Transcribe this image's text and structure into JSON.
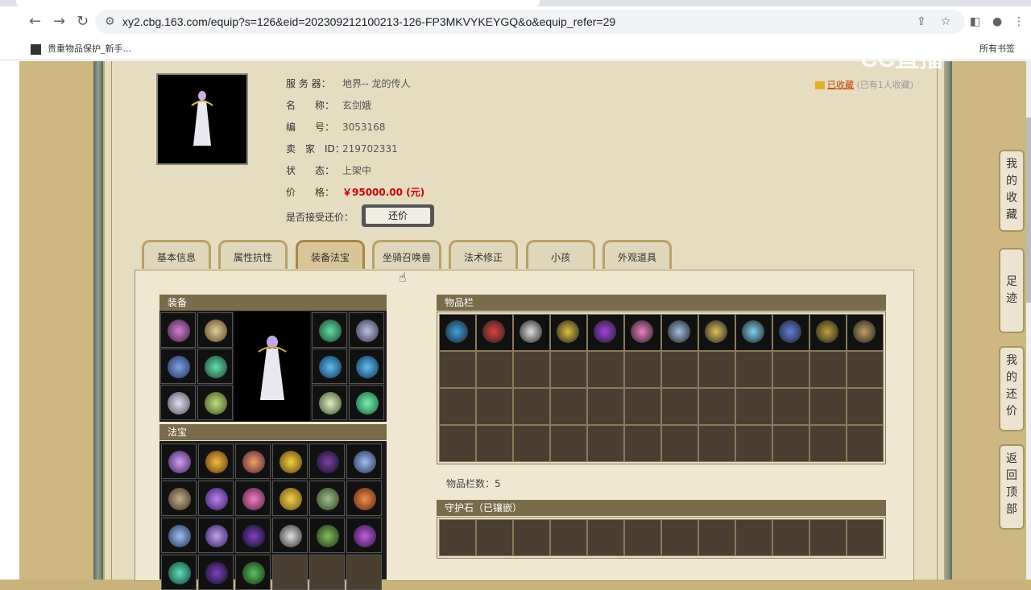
{
  "browser": {
    "url": "xy2.cbg.163.com/equip?s=126&eid=202309212100213-126-FP3MKVYKEYGQ&o&equip_refer=29",
    "bookmark": "贵重物品保护_新手...",
    "all_bookmarks": "所有书签",
    "watermark": "CC直播"
  },
  "product": {
    "server_label": "服 务 器：",
    "server": "地界-- 龙的传人",
    "name_label": "名　　称：",
    "name": "玄剑娥",
    "id_label": "编　　号：",
    "id": "3053168",
    "seller_label": "卖　家　ID：",
    "seller_id": "219702331",
    "status_label": "状　　态：",
    "status": "上架中",
    "price_label": "价　　格：",
    "price": "￥95000.00 (元)",
    "bargain_label": "是否接受还价：",
    "bargain_button": "还价",
    "favorited": "已收藏",
    "favorited_count": "(已有1人收藏)"
  },
  "tabs": [
    "基本信息",
    "属性抗性",
    "装备法宝",
    "坐骑召唤兽",
    "法术修正",
    "小孩",
    "外观道具"
  ],
  "active_tab": "装备法宝",
  "sections": {
    "equipment": "装备",
    "treasure": "法宝",
    "inventory": "物品栏",
    "inventory_count": "物品栏数：5",
    "guard_stone": "守护石（已镶嵌）"
  },
  "side_nav": [
    "我的收藏",
    "足迹",
    "我的还价",
    "返回顶部"
  ],
  "colors": {
    "price": "#cc0000",
    "section_header": "#7a6b4a",
    "slot_bg": "#4a3f30",
    "panel_bg": "#e6dcc0"
  }
}
